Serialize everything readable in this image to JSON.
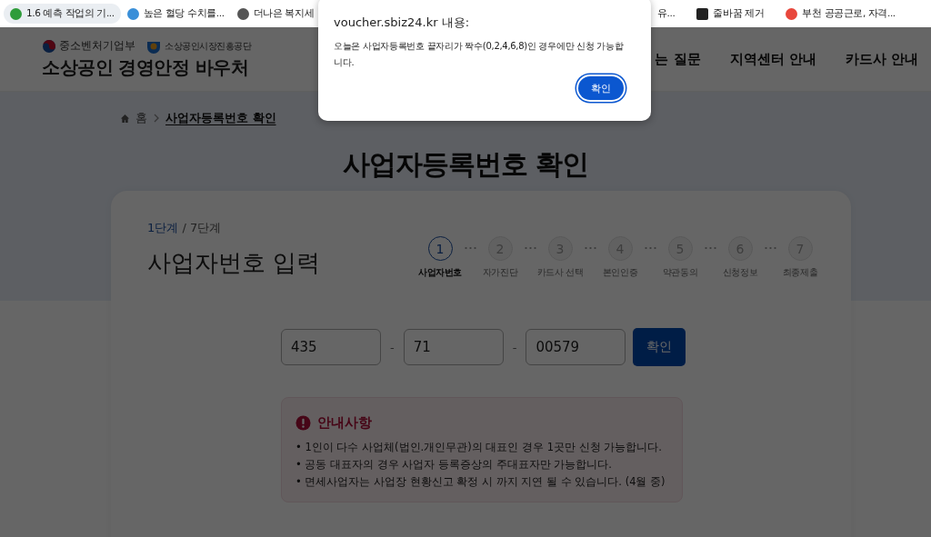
{
  "bookmarks": [
    {
      "label": "1.6 예측 작업의 기...",
      "selected": true
    },
    {
      "label": "높은 혈당 수치를...",
      "selected": false
    },
    {
      "label": "더나은 복지세",
      "selected": false
    },
    {
      "label": "유...",
      "selected": false
    },
    {
      "label": "줄바꿈 제거",
      "selected": false
    },
    {
      "label": "부천 공공근로, 자격...",
      "selected": false
    }
  ],
  "header": {
    "ministry": "중소벤처기업부",
    "agency": "소상공인시장진흥공단",
    "site_title": "소상공인 경영안정 바우처",
    "nav": [
      "는 질문",
      "지역센터 안내",
      "카드사 안내"
    ]
  },
  "breadcrumb": {
    "home": "홈",
    "current": "사업자등록번호 확인"
  },
  "page_title": "사업자등록번호 확인",
  "card": {
    "step_current": "1단계",
    "step_total": "/ 7단계",
    "heading": "사업자번호 입력",
    "steps": [
      {
        "number": "1",
        "label": "사업자번호",
        "selected": true
      },
      {
        "number": "2",
        "label": "자가진단",
        "selected": false
      },
      {
        "number": "3",
        "label": "카드사 선택",
        "selected": false
      },
      {
        "number": "4",
        "label": "본인인증",
        "selected": false
      },
      {
        "number": "5",
        "label": "약관동의",
        "selected": false
      },
      {
        "number": "6",
        "label": "신청정보",
        "selected": false
      },
      {
        "number": "7",
        "label": "최종제출",
        "selected": false
      }
    ],
    "fields": [
      {
        "value": "435"
      },
      {
        "value": "71"
      },
      {
        "value": "00579"
      }
    ],
    "separator": "-",
    "confirm_button": "확인",
    "notice": {
      "title": "안내사항",
      "items": [
        "• 1인이 다수 사업체(법인.개인무관)의 대표인 경우 1곳만 신청 가능합니다.",
        "• 공동 대표자의 경우 사업자 등록증상의 주대표자만 가능합니다.",
        "• 면세사업자는 사업장 현황신고 확정 시 까지 지연 될 수 있습니다. (4월 중)"
      ]
    }
  },
  "dialog": {
    "title": "voucher.sbiz24.kr 내용:",
    "message": "오늘은 사업자등록번호 끝자리가 짝수(0,2,4,6,8)인 경우에만 신청 가능합니다.",
    "button": "확인"
  }
}
